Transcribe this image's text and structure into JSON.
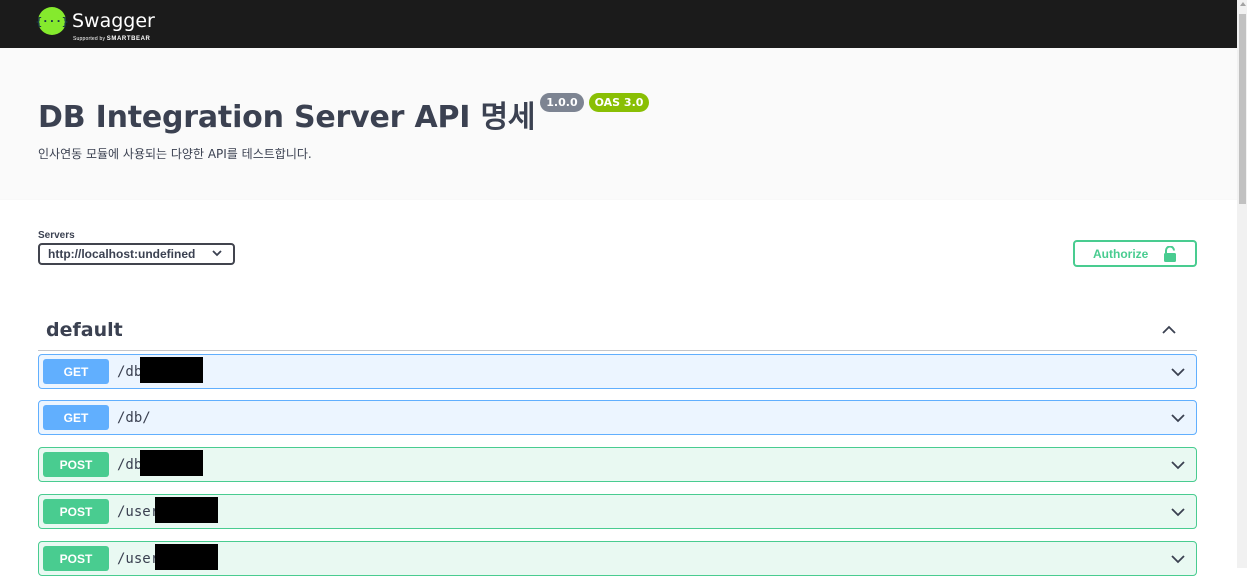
{
  "topbar": {
    "logo_glyph": "{···}",
    "brand": "Swagger",
    "supported_by": "Supported by",
    "sponsor": "SMARTBEAR"
  },
  "info": {
    "title": "DB Integration Server API 명세",
    "version": "1.0.0",
    "oas": "OAS 3.0",
    "description": "인사연동 모듈에 사용되는 다양한 API를 테스트합니다."
  },
  "servers": {
    "label": "Servers",
    "selected": "http://localhost:undefined"
  },
  "authorize": {
    "label": "Authorize",
    "icon": "unlock-icon"
  },
  "tag": {
    "name": "default",
    "toggle_icon": "chevron-up-icon"
  },
  "operations": [
    {
      "method": "GET",
      "path": "/db"
    },
    {
      "method": "GET",
      "path": "/db/"
    },
    {
      "method": "POST",
      "path": "/db"
    },
    {
      "method": "POST",
      "path": "/user/"
    },
    {
      "method": "POST",
      "path": "/user/"
    }
  ],
  "colors": {
    "get": "#61affe",
    "post": "#49cc90",
    "topbar": "#1b1b1b",
    "logo": "#85ea2d",
    "oas_badge": "#89bf04",
    "version_badge": "#7d8492"
  }
}
